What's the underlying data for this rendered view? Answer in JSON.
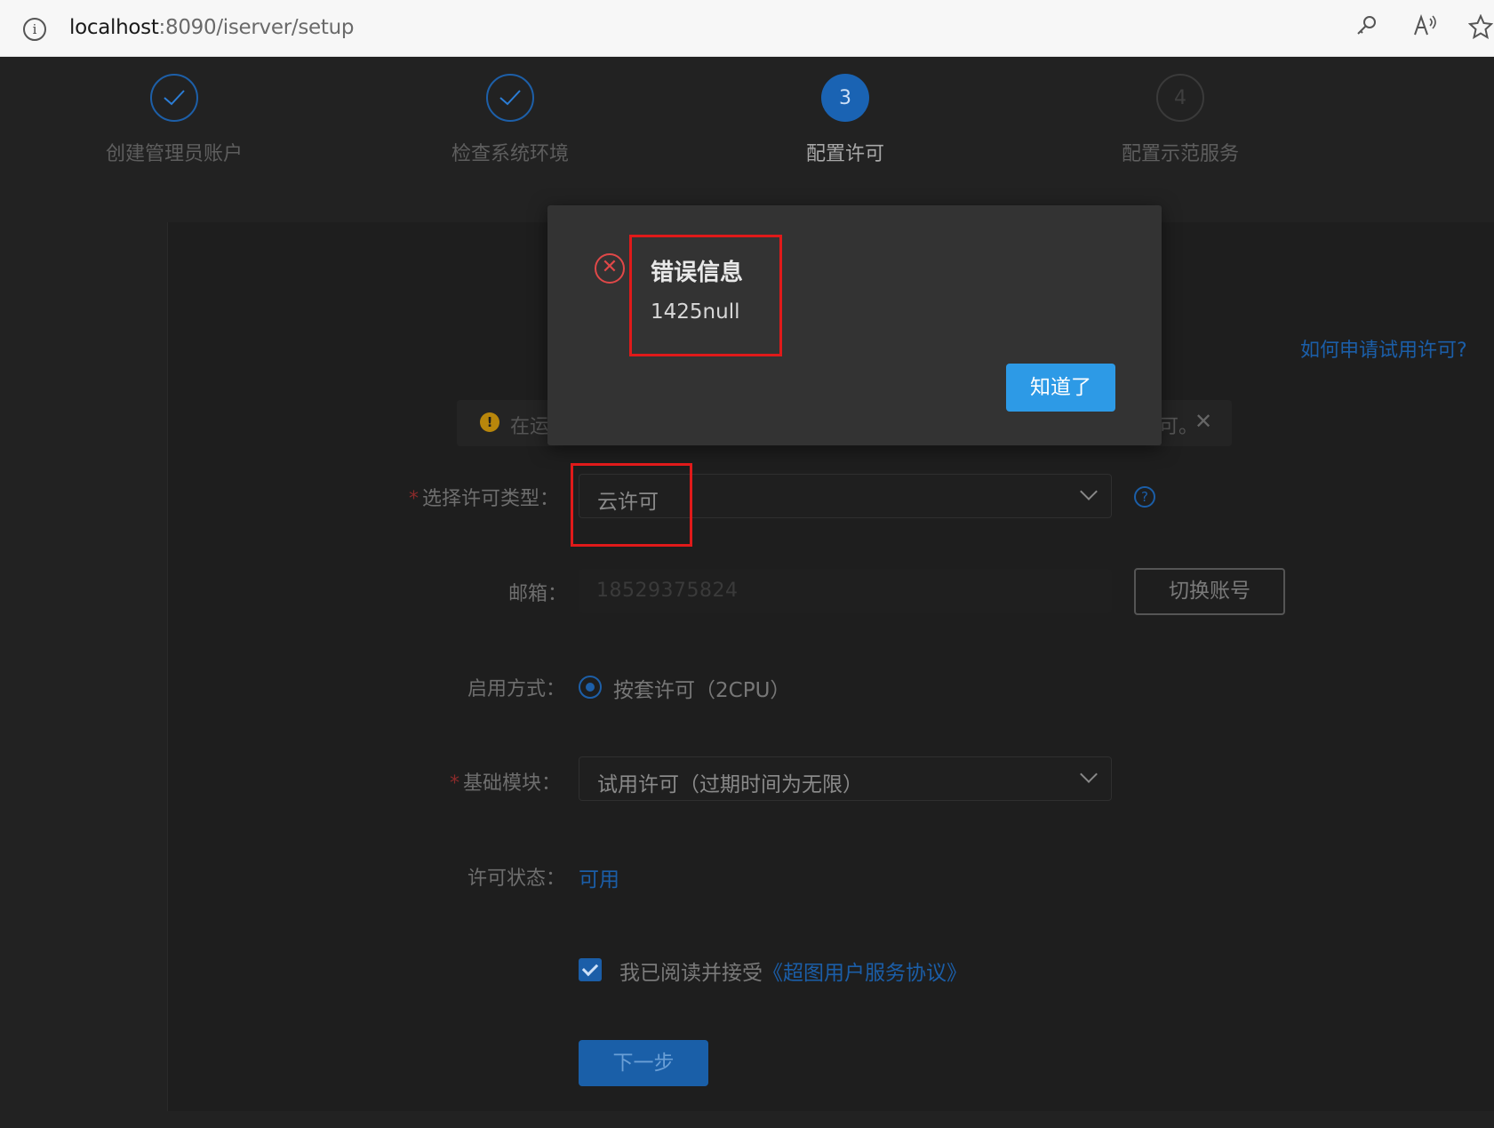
{
  "browser": {
    "url_host": "localhost",
    "url_path": ":8090/iserver/setup",
    "icons": [
      "info-icon",
      "key-icon",
      "read-aloud-icon",
      "favorite-star-icon"
    ]
  },
  "steps": [
    {
      "number": "",
      "label": "创建管理员账户",
      "state": "done"
    },
    {
      "number": "",
      "label": "检查系统环境",
      "state": "done"
    },
    {
      "number": "3",
      "label": "配置许可",
      "state": "active"
    },
    {
      "number": "4",
      "label": "配置示范服务",
      "state": "todo"
    }
  ],
  "help_link": "如何申请试用许可?",
  "notice": {
    "text_left": "在运",
    "text_right": "可。"
  },
  "form": {
    "license_type_label": "选择许可类型：",
    "license_type_value": "云许可",
    "email_label": "邮箱：",
    "email_value": "18529375824",
    "switch_account": "切换账号",
    "enable_label": "启用方式：",
    "enable_option": "按套许可（2CPU）",
    "base_module_label": "基础模块：",
    "base_module_value": "试用许可（过期时间为无限）",
    "status_label": "许可状态：",
    "status_value": "可用",
    "agree_text": "我已阅读并接受",
    "agree_link": "《超图用户服务协议》",
    "next": "下一步"
  },
  "modal": {
    "title": "错误信息",
    "message": "1425null",
    "ok": "知道了"
  },
  "colors": {
    "accent": "#2d9ae6",
    "error": "#e04848",
    "highlight": "#e01a1a"
  }
}
